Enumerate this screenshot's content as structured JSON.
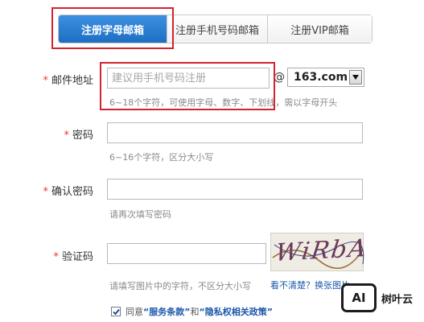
{
  "tabs": [
    {
      "label": "注册字母邮箱",
      "active": true
    },
    {
      "label": "注册手机号码邮箱",
      "active": false
    },
    {
      "label": "注册VIP邮箱",
      "active": false
    }
  ],
  "required_mark": "*",
  "email": {
    "label": "邮件地址",
    "placeholder": "建议用手机号码注册",
    "hint": "6~18个字符，可使用字母、数字、下划线，需以字母开头",
    "at": "@",
    "domain": "163.com"
  },
  "password": {
    "label": "密码",
    "hint": "6~16个字符，区分大小写"
  },
  "confirm_password": {
    "label": "确认密码",
    "hint": "请再次填写密码"
  },
  "captcha": {
    "label": "验证码",
    "hint": "请填写图片中的字符，不区分大小写",
    "image_text": "WiRbA",
    "refresh_link": "看不清楚？换张图片"
  },
  "agreement": {
    "prefix": "同意",
    "terms": "“服务条款”",
    "and": "和",
    "privacy": "“隐私权相关政策”",
    "checked": true
  },
  "watermark": {
    "logo_text": "AI",
    "name": "树叶云"
  },
  "colors": {
    "tab_active": "#1d6fc4",
    "highlight": "#d3232e",
    "link": "#1a56a8",
    "required": "#ee3333"
  }
}
